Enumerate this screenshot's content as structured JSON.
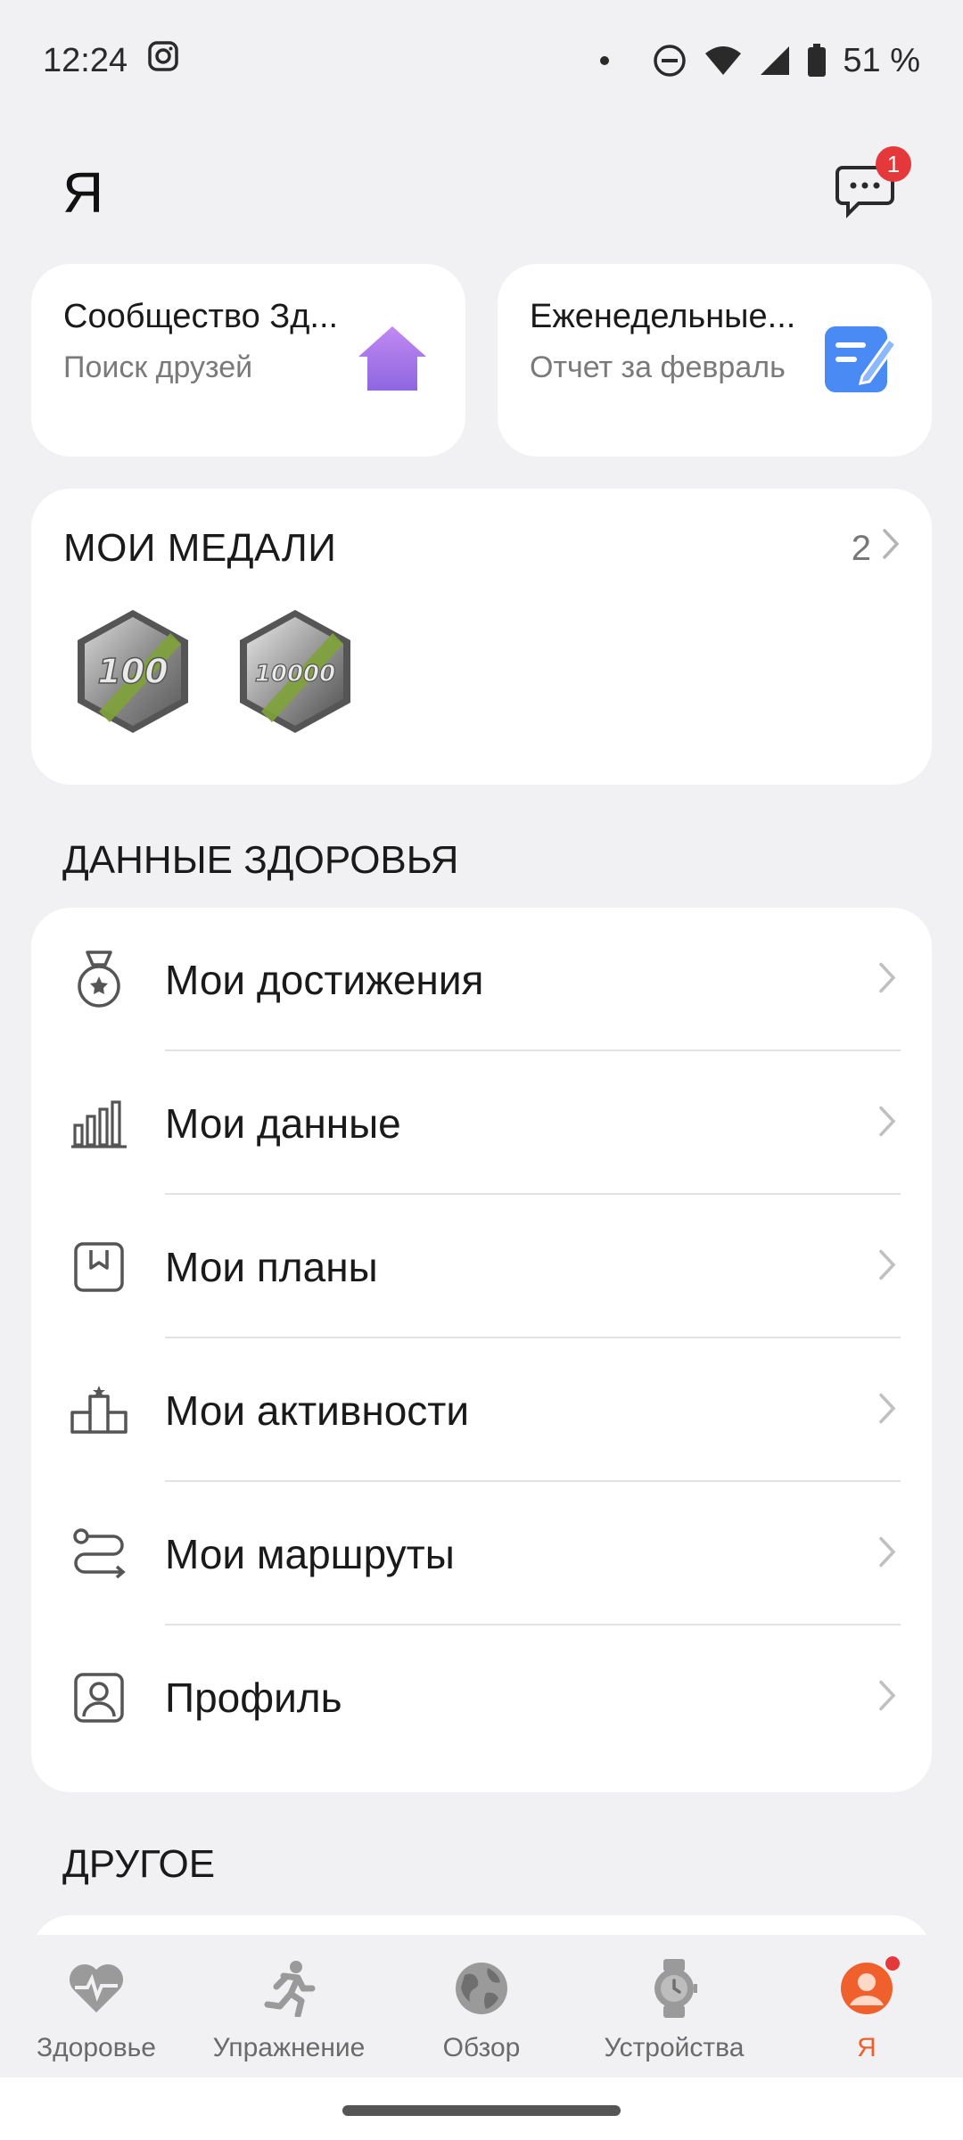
{
  "status_bar": {
    "time": "12:24",
    "battery": "51 %"
  },
  "header": {
    "title": "Я",
    "messages_badge": "1"
  },
  "cards": [
    {
      "title": "Сообщество Зд...",
      "subtitle": "Поиск друзей",
      "icon": "house-icon",
      "icon_color": "#a77be6"
    },
    {
      "title": "Еженедельные...",
      "subtitle": "Отчет за февраль",
      "icon": "report-icon",
      "icon_color": "#4a8af4"
    }
  ],
  "medals": {
    "title": "МОИ МЕДАЛИ",
    "count": "2",
    "items": [
      {
        "label": "100"
      },
      {
        "label": "10000"
      }
    ]
  },
  "health": {
    "title": "ДАННЫЕ ЗДОРОВЬЯ",
    "items": [
      {
        "label": "Мои достижения",
        "icon": "medal-icon"
      },
      {
        "label": "Мои данные",
        "icon": "bar-chart-icon"
      },
      {
        "label": "Мои планы",
        "icon": "plan-icon"
      },
      {
        "label": "Мои активности",
        "icon": "podium-icon"
      },
      {
        "label": "Мои маршруты",
        "icon": "route-icon"
      },
      {
        "label": "Профиль",
        "icon": "profile-icon"
      }
    ]
  },
  "other": {
    "title": "ДРУГОЕ"
  },
  "nav": {
    "accent": "#f0602c",
    "items": [
      {
        "label": "Здоровье",
        "icon": "heart-pulse-icon"
      },
      {
        "label": "Упражнение",
        "icon": "runner-icon"
      },
      {
        "label": "Обзор",
        "icon": "globe-icon"
      },
      {
        "label": "Устройства",
        "icon": "watch-icon"
      },
      {
        "label": "Я",
        "icon": "avatar-icon"
      }
    ]
  }
}
